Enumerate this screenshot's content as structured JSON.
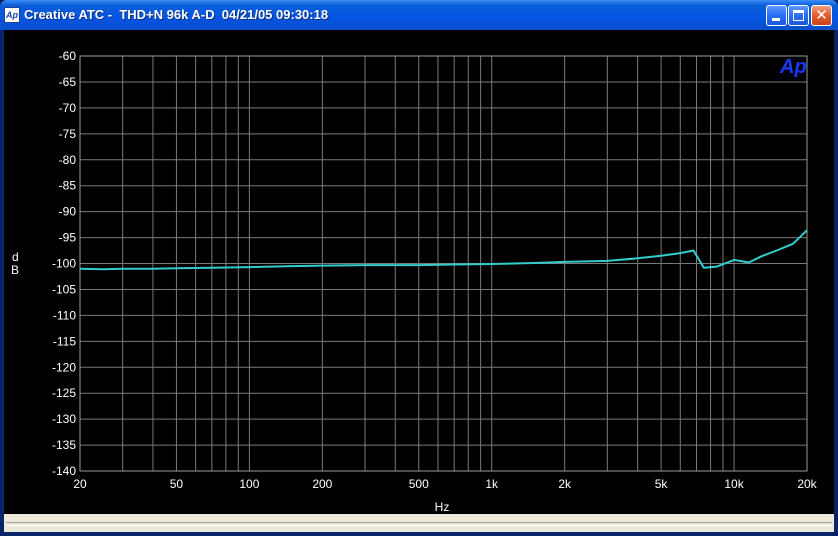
{
  "window": {
    "title": "Creative ATC -  THD+N 96k A-D  04/21/05 09:30:18",
    "icon_label": "Ap",
    "controls": [
      "minimize",
      "maximize",
      "close"
    ],
    "titlebar_color": "#0654e3",
    "close_button_color": "#e35b2e"
  },
  "chart_data": {
    "type": "line",
    "title": "",
    "xlabel": "Hz",
    "ylabel_chars": [
      "d",
      "B"
    ],
    "logo": "Ap",
    "xscale": "log",
    "xlim": [
      20,
      20000
    ],
    "ylim": [
      -140,
      -60
    ],
    "grid": true,
    "background": "#000000",
    "grid_color": "#7a7a7a",
    "line_color": "#33cccc",
    "logo_color": "#1a37ff",
    "y_ticks": [
      -60,
      -65,
      -70,
      -75,
      -80,
      -85,
      -90,
      -95,
      -100,
      -105,
      -110,
      -115,
      -120,
      -125,
      -130,
      -135,
      -140
    ],
    "y_tick_labels": [
      "-60",
      "-65",
      "-70",
      "-75",
      "-80",
      "-85",
      "-90",
      "-95",
      "-100",
      "-105",
      "-110",
      "-115",
      "-120",
      "-125",
      "-130",
      "-135",
      "-140"
    ],
    "x_ticks": [
      20,
      50,
      100,
      200,
      500,
      1000,
      2000,
      5000,
      10000,
      20000
    ],
    "x_tick_labels": [
      "20",
      "50",
      "100",
      "200",
      "500",
      "1k",
      "2k",
      "5k",
      "10k",
      "20k"
    ],
    "series": [
      {
        "x": [
          20,
          25,
          30,
          40,
          50,
          70,
          100,
          150,
          200,
          300,
          400,
          500,
          700,
          1000,
          1500,
          2000,
          3000,
          4000,
          5000,
          6000,
          6800,
          7500,
          8500,
          10000,
          11500,
          13000,
          15000,
          17500,
          20000
        ],
        "y": [
          -101.0,
          -101.1,
          -101.0,
          -101.0,
          -100.9,
          -100.8,
          -100.7,
          -100.5,
          -100.4,
          -100.3,
          -100.3,
          -100.3,
          -100.2,
          -100.1,
          -99.9,
          -99.7,
          -99.5,
          -99.0,
          -98.5,
          -98.0,
          -97.5,
          -100.8,
          -100.6,
          -99.3,
          -99.8,
          -98.6,
          -97.5,
          -96.2,
          -93.6
        ]
      }
    ]
  }
}
